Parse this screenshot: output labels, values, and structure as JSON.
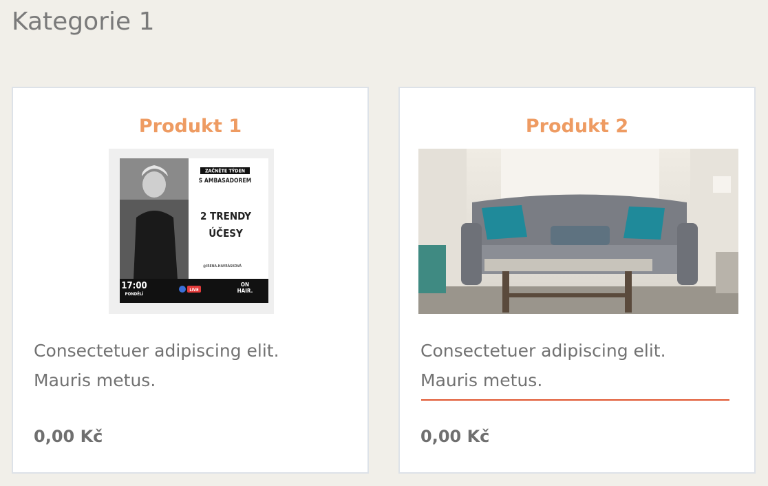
{
  "category": {
    "title": "Kategorie 1"
  },
  "products": [
    {
      "name": "Produkt 1",
      "description": [
        "Consectetuer adipiscing elit.",
        "Mauris metus."
      ],
      "price": "0,00 Kč",
      "image": {
        "badge_line1": "ZAČNĚTE TÝDEN",
        "badge_line2": "S AMBASADOREM",
        "headline_line1": "2 TRENDY",
        "headline_line2": "ÚČESY",
        "handle": "@IRENA.HAVRÁSKOVÁ",
        "time": "17:00",
        "day": "PONDĚLÍ",
        "live": "LIVE",
        "brand_line1": "ON",
        "brand_line2": "HAIR."
      }
    },
    {
      "name": "Produkt 2",
      "description": [
        "Consectetuer adipiscing elit.",
        "Mauris metus."
      ],
      "price": "0,00 Kč",
      "image": {}
    }
  ]
}
